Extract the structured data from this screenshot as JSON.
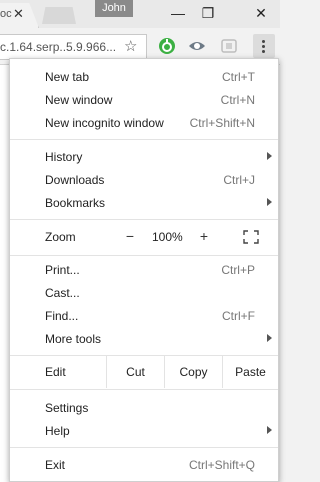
{
  "titlebar": {
    "active_tab_text": "oc",
    "profile_name": "John",
    "minimize": "—",
    "maximize": "❐",
    "close": "✕"
  },
  "toolbar": {
    "omnibox_text": "c.1.64.serp..5.9.966..."
  },
  "menu": {
    "new_tab": {
      "label": "New tab",
      "shortcut": "Ctrl+T"
    },
    "new_window": {
      "label": "New window",
      "shortcut": "Ctrl+N"
    },
    "new_incognito": {
      "label": "New incognito window",
      "shortcut": "Ctrl+Shift+N"
    },
    "history": {
      "label": "History"
    },
    "downloads": {
      "label": "Downloads",
      "shortcut": "Ctrl+J"
    },
    "bookmarks": {
      "label": "Bookmarks"
    },
    "zoom": {
      "label": "Zoom",
      "minus": "−",
      "value": "100%",
      "plus": "+"
    },
    "print": {
      "label": "Print...",
      "shortcut": "Ctrl+P"
    },
    "cast": {
      "label": "Cast..."
    },
    "find": {
      "label": "Find...",
      "shortcut": "Ctrl+F"
    },
    "more_tools": {
      "label": "More tools"
    },
    "edit": {
      "label": "Edit",
      "cut": "Cut",
      "copy": "Copy",
      "paste": "Paste"
    },
    "settings": {
      "label": "Settings"
    },
    "help": {
      "label": "Help"
    },
    "exit": {
      "label": "Exit",
      "shortcut": "Ctrl+Shift+Q"
    }
  },
  "colors": {
    "menu_bg": "#ffffff",
    "separator": "#e3e3e3",
    "shortcut_text": "#777777",
    "ext_green": "#3cb043"
  }
}
